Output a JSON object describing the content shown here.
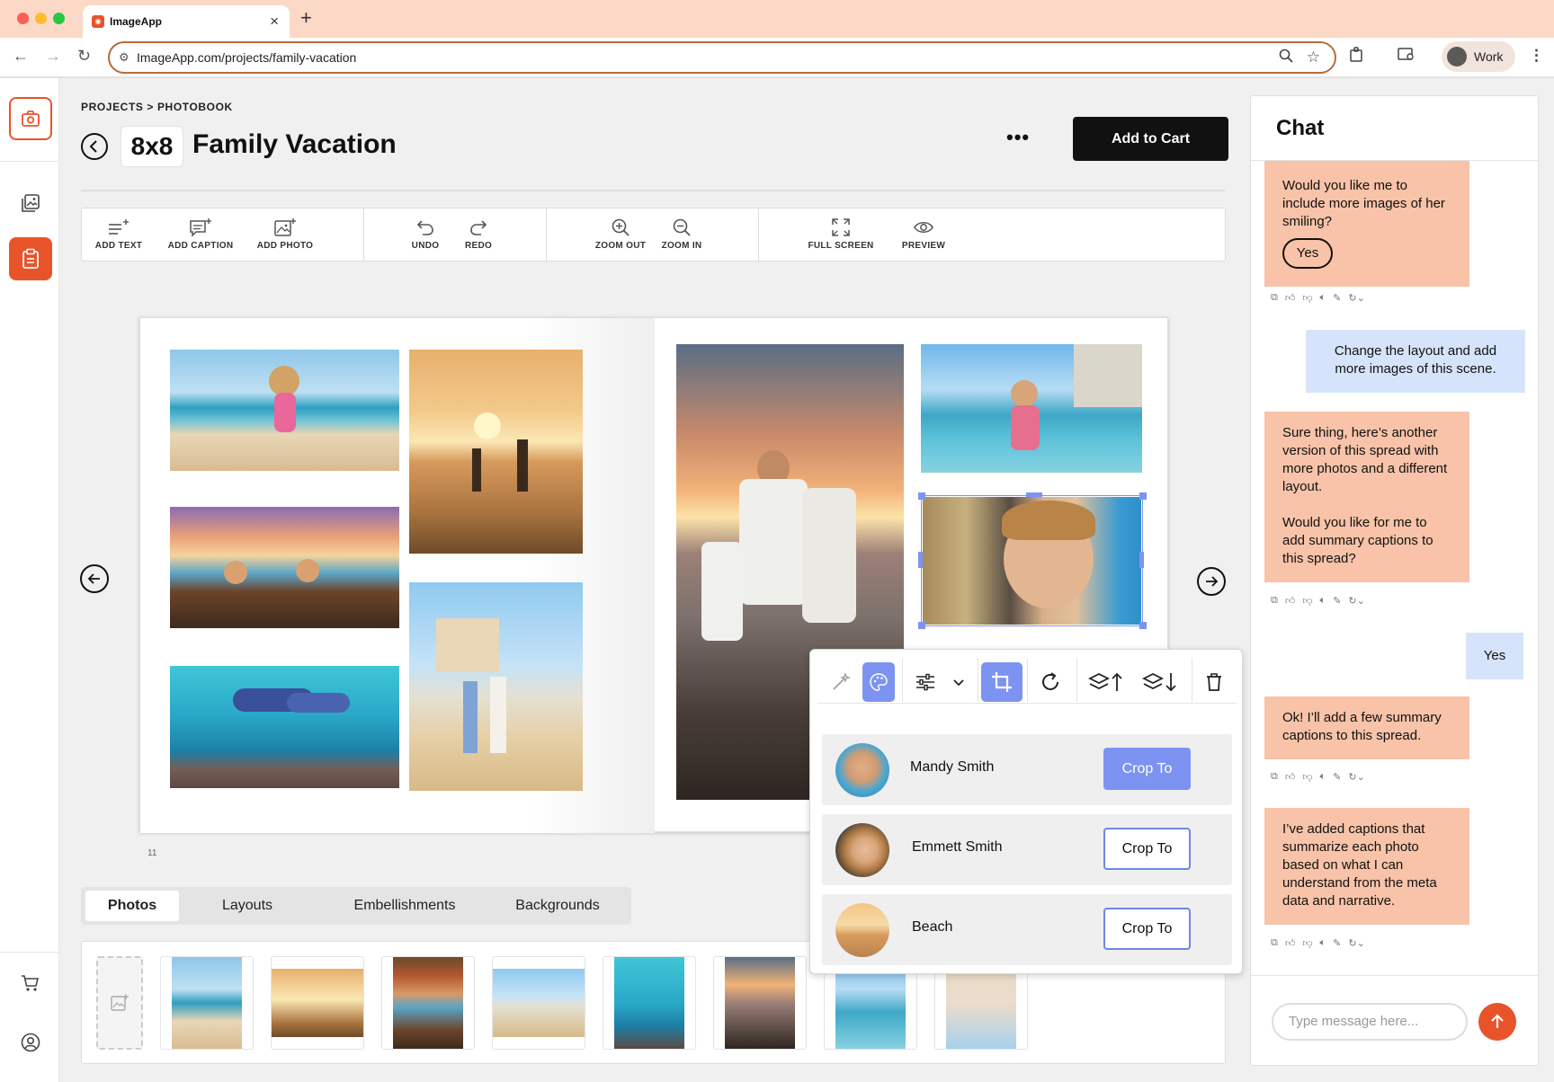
{
  "browser": {
    "tab_title": "ImageApp",
    "url": "ImageApp.com/projects/family-vacation",
    "profile": "Work"
  },
  "header": {
    "breadcrumb": "PROJECTS > PHOTOBOOK",
    "size": "8x8",
    "title": "Family Vacation",
    "more": "•••",
    "cart_label": "Add to Cart"
  },
  "toolbar": {
    "add_text": "ADD TEXT",
    "add_caption": "ADD CAPTION",
    "add_photo": "ADD PHOTO",
    "undo": "UNDO",
    "redo": "REDO",
    "zoom_out": "ZOOM OUT",
    "zoom_in": "ZOOM IN",
    "full_screen": "FULL SCREEN",
    "preview": "PREVIEW"
  },
  "page_number": "11",
  "tabs": [
    "Photos",
    "Layouts",
    "Embellishments",
    "Backgrounds"
  ],
  "crop_options": [
    {
      "name": "Mandy Smith",
      "button": "Crop To"
    },
    {
      "name": "Emmett Smith",
      "button": "Crop To"
    },
    {
      "name": "Beach",
      "button": "Crop To"
    }
  ],
  "chat": {
    "title": "Chat",
    "messages": [
      {
        "from": "bot",
        "text": "Would you like me to include more images of her smiling?",
        "chip": "Yes"
      },
      {
        "from": "user",
        "text": "Change the layout and add more images of this scene."
      },
      {
        "from": "bot",
        "text": "Sure thing, here’s another version of this spread with more photos and a different layout.",
        "text2": "Would you like for me to add summary captions to this spread?"
      },
      {
        "from": "user",
        "text": "Yes"
      },
      {
        "from": "bot",
        "text": "Ok! I’ll add a few summary captions to this spread."
      },
      {
        "from": "bot",
        "text": "I’ve added captions that summarize each photo based on what I can understand from the meta data and narrative."
      }
    ],
    "input_placeholder": "Type message here..."
  },
  "colors": {
    "accent": "#e8532a",
    "selection": "#7d93f2",
    "bot_bubble": "#f8c3a8",
    "user_bubble": "#d6e4fb"
  }
}
